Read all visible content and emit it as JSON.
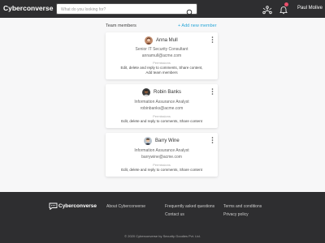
{
  "header": {
    "brand": "Cyberconverse",
    "search_placeholder": "What do you looking for?",
    "user_name": "Paul Molive"
  },
  "section": {
    "title": "Team members",
    "add_label": "+ Add new member"
  },
  "members": [
    {
      "name": "Anna Mull",
      "title": "Senior IT Security Consultant",
      "email": "annamull@acme.com",
      "permissions_label": "Permissions",
      "permissions_line1": "Edit, delete and reply to comments, Share content,",
      "permissions_line2": "Add team members"
    },
    {
      "name": "Robin Banks",
      "title": "Information Assurance Analyst",
      "email": "robinbanks@acme.com",
      "permissions_label": "Permissions",
      "permissions_line1": "Edit, delete and reply to comments, Share content"
    },
    {
      "name": "Barry Wine",
      "title": "Information Assurance Analyst",
      "email": "barrywine@acme.com",
      "permissions_label": "Permissions",
      "permissions_line1": "Edit, delete and reply to comments, Share content"
    }
  ],
  "footer": {
    "brand": "Cyberconverse",
    "links": {
      "about": "About Cyberconverse",
      "faq": "Frequently asked questions",
      "contact": "Contact us",
      "terms": "Terms and conditions",
      "privacy": "Privacy policy"
    },
    "copyright": "© 2020 Cyberconverse by Security Goodies Pvt. Ltd."
  },
  "icons": {
    "search": "search-icon",
    "network": "network-icon",
    "bell": "bell-icon",
    "more": "more-vertical-icon",
    "logo": "cyberconverse-logo-icon"
  },
  "colors": {
    "header_bg": "#2e2e30",
    "accent": "#2aa7d8",
    "notification": "#e94f6b"
  }
}
